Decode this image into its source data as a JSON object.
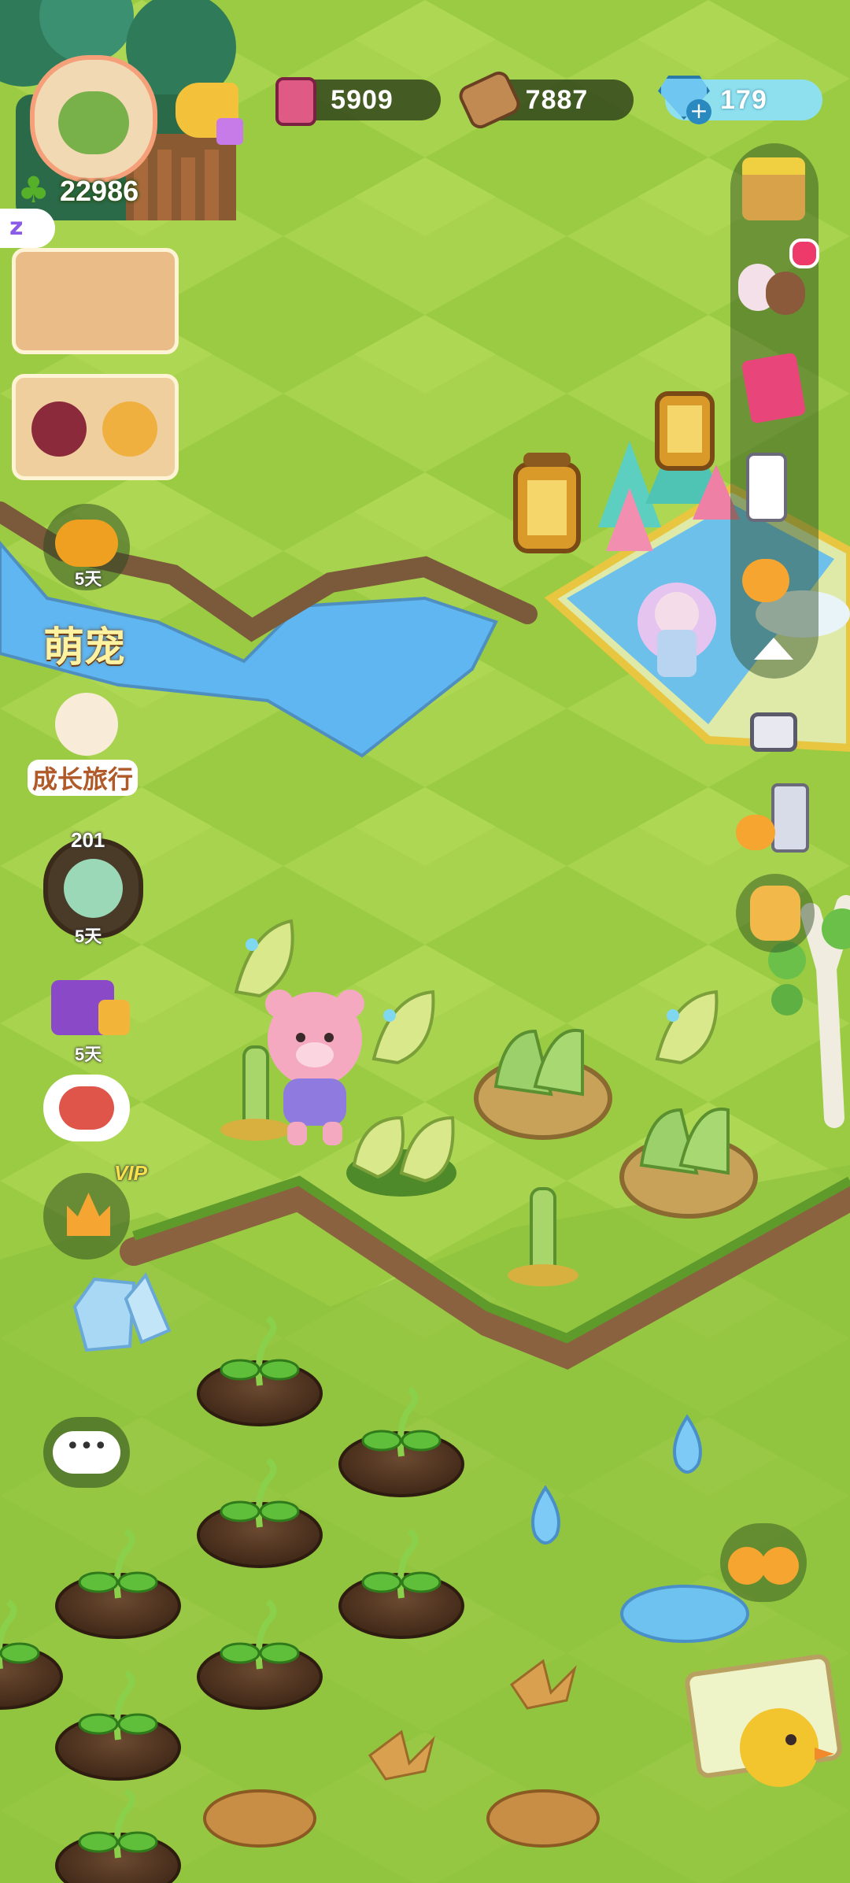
{
  "resources": {
    "ink": "5909",
    "wood": "7887",
    "gems": "179"
  },
  "player": {
    "clover_count": "22986"
  },
  "left_panel": {
    "event1_days": "5天",
    "pet_label": "萌宠",
    "journey_label": "成长旅行",
    "plant_count": "201",
    "plant_days": "5天",
    "gift_days": "5天",
    "vip_label": "VIP"
  },
  "colors": {
    "grass_light": "#a5d24a",
    "grass_dark": "#86c038",
    "water": "#5fb6f0",
    "soil": "#5a3b26",
    "hud_pill": "#283a18",
    "gem_pill": "#8fe0ee"
  },
  "icons": [
    "ink-bottle-icon",
    "wood-log-icon",
    "gem-icon",
    "clover-icon",
    "megaphone-icon",
    "shop-icon",
    "animal-friends-icon",
    "book-icon",
    "remote-icon",
    "cleaning-icon",
    "collapse-arrow-icon",
    "camera-icon",
    "phone-icon",
    "backpack-icon",
    "chat-bubble-icon",
    "duck-pair-icon"
  ]
}
